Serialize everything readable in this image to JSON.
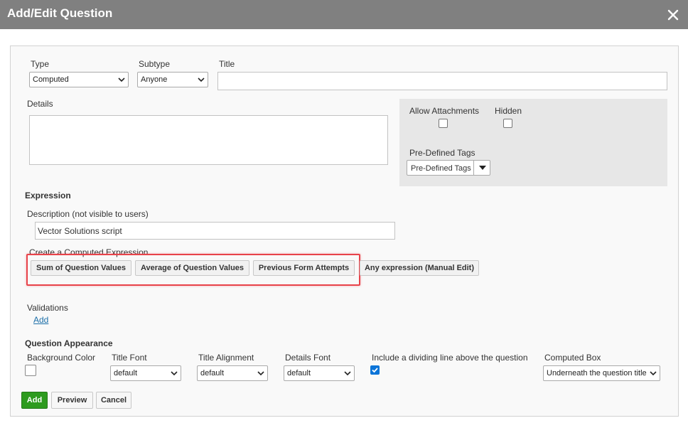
{
  "dialog": {
    "title": "Add/Edit Question",
    "close_icon": "close-icon"
  },
  "form": {
    "type": {
      "label": "Type",
      "value": "Computed"
    },
    "subtype": {
      "label": "Subtype",
      "value": "Anyone"
    },
    "title": {
      "label": "Title",
      "value": ""
    },
    "details": {
      "label": "Details",
      "value": ""
    },
    "allow_attachments": {
      "label": "Allow Attachments",
      "checked": false
    },
    "hidden": {
      "label": "Hidden",
      "checked": false
    },
    "predefined_tags": {
      "label": "Pre-Defined Tags",
      "value": "Pre-Defined Tags"
    }
  },
  "expression": {
    "heading": "Expression",
    "description_label": "Description (not visible to users)",
    "description_value": "Vector Solutions script",
    "create_label": "Create a Computed Expression",
    "buttons": [
      "Sum of Question Values",
      "Average of Question Values",
      "Previous Form Attempts",
      "Any expression (Manual Edit)"
    ]
  },
  "validations": {
    "label": "Validations",
    "add_link": "Add"
  },
  "appearance": {
    "heading": "Question Appearance",
    "background_color": {
      "label": "Background Color"
    },
    "title_font": {
      "label": "Title Font",
      "value": "default"
    },
    "title_alignment": {
      "label": "Title Alignment",
      "value": "default"
    },
    "details_font": {
      "label": "Details Font",
      "value": "default"
    },
    "dividing_line": {
      "label": "Include a dividing line above the question",
      "checked": true
    },
    "computed_box": {
      "label": "Computed Box",
      "value": "Underneath the question title"
    }
  },
  "footer": {
    "add": "Add",
    "preview": "Preview",
    "cancel": "Cancel"
  },
  "colors": {
    "titlebar": "#808080",
    "primary_button": "#2d9b1e",
    "highlight": "#e8434a",
    "checkbox_checked": "#0b74d8",
    "link": "#1b6ea8"
  }
}
